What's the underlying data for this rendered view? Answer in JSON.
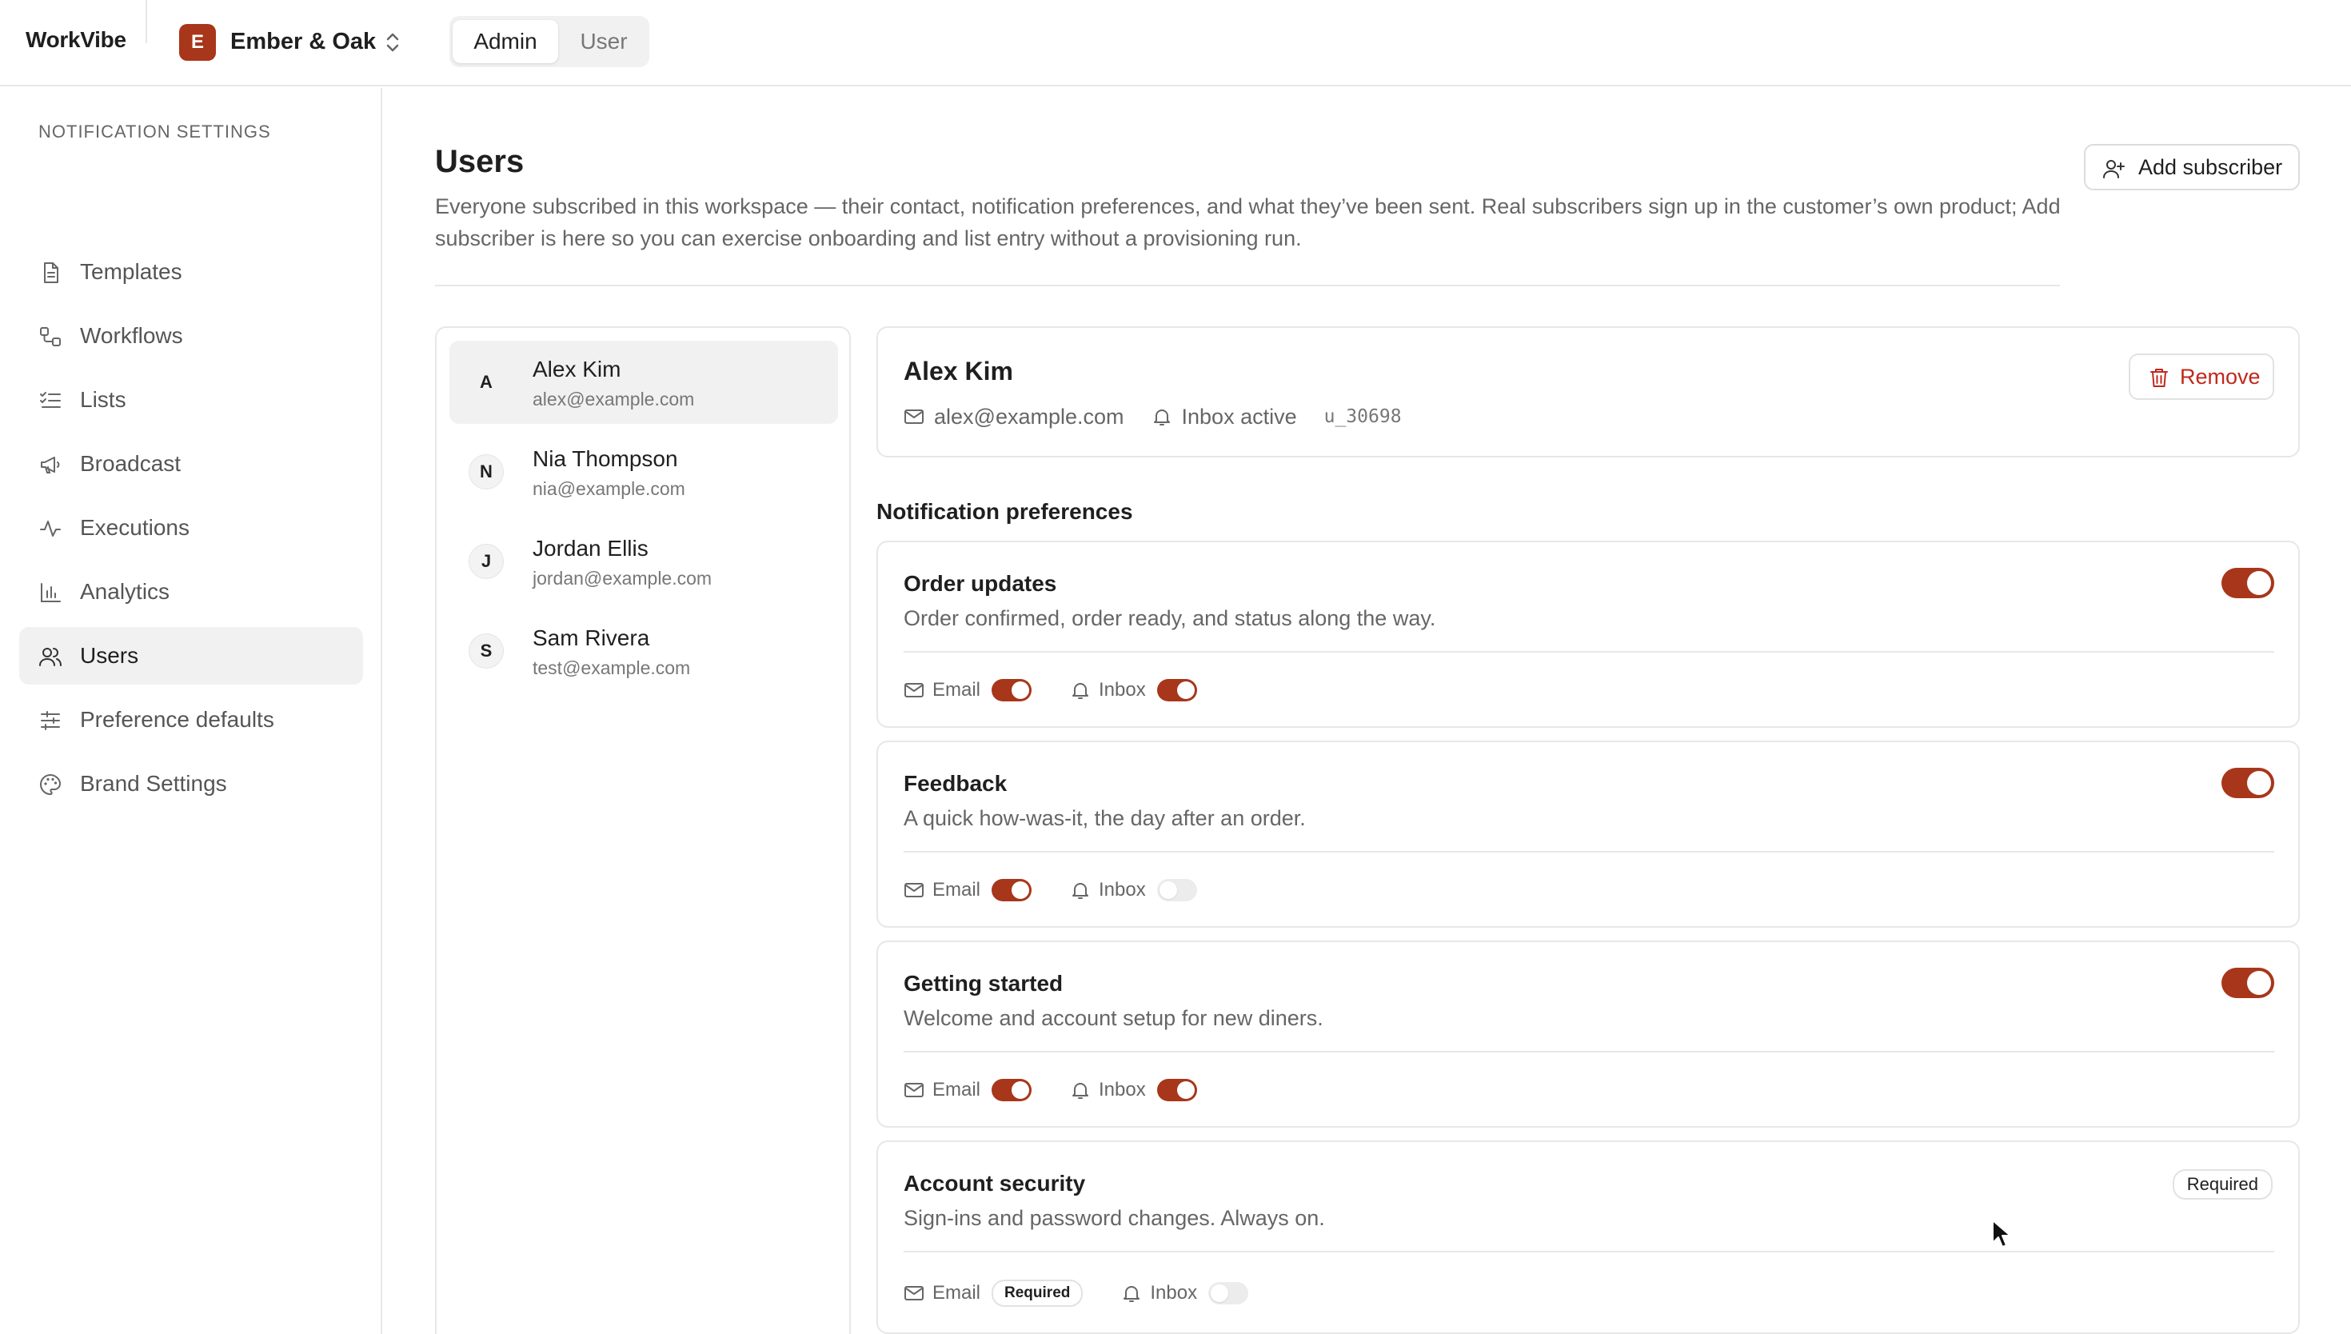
{
  "app": {
    "brand": "WorkVibe",
    "workspace": {
      "initial": "E",
      "name": "Ember & Oak"
    },
    "mode_tabs": {
      "admin": "Admin",
      "user": "User",
      "selected": "Admin"
    }
  },
  "sidebar": {
    "heading": "NOTIFICATION SETTINGS",
    "items": [
      {
        "label": "Templates",
        "icon": "document-icon"
      },
      {
        "label": "Workflows",
        "icon": "workflow-icon"
      },
      {
        "label": "Lists",
        "icon": "checklist-icon"
      },
      {
        "label": "Broadcast",
        "icon": "megaphone-icon"
      },
      {
        "label": "Executions",
        "icon": "activity-icon"
      },
      {
        "label": "Analytics",
        "icon": "bar-chart-icon"
      },
      {
        "label": "Users",
        "icon": "users-icon",
        "active": true
      },
      {
        "label": "Preference defaults",
        "icon": "sliders-icon"
      },
      {
        "label": "Brand Settings",
        "icon": "palette-icon"
      }
    ]
  },
  "page": {
    "title": "Users",
    "description": "Everyone subscribed in this workspace — their contact, notification preferences, and what they’ve been sent. Real subscribers sign up in the customer’s own product; Add subscriber is here so you can exercise onboarding and list entry without a provisioning run.",
    "add_button": "Add subscriber"
  },
  "users": [
    {
      "initial": "A",
      "name": "Alex Kim",
      "email": "alex@example.com",
      "selected": true
    },
    {
      "initial": "N",
      "name": "Nia Thompson",
      "email": "nia@example.com"
    },
    {
      "initial": "J",
      "name": "Jordan Ellis",
      "email": "jordan@example.com"
    },
    {
      "initial": "S",
      "name": "Sam Rivera",
      "email": "test@example.com"
    }
  ],
  "detail": {
    "name": "Alex Kim",
    "email": "alex@example.com",
    "inbox_status": "Inbox active",
    "user_id": "u_30698",
    "remove_button": "Remove"
  },
  "preferences": {
    "heading": "Notification preferences",
    "email_label": "Email",
    "inbox_label": "Inbox",
    "required_label": "Required",
    "items": [
      {
        "title": "Order updates",
        "description": "Order confirmed, order ready, and status along the way.",
        "enabled": true,
        "email": true,
        "inbox": true
      },
      {
        "title": "Feedback",
        "description": "A quick how-was-it, the day after an order.",
        "enabled": true,
        "email": true,
        "inbox": false
      },
      {
        "title": "Getting started",
        "description": "Welcome and account setup for new diners.",
        "enabled": true,
        "email": true,
        "inbox": true
      },
      {
        "title": "Account security",
        "description": "Sign-ins and password changes. Always on.",
        "required": true,
        "email_required": true,
        "inbox": false
      }
    ]
  },
  "colors": {
    "accent": "#a8361a",
    "danger": "#c0281c",
    "border": "#e7e7e7",
    "muted_text": "#666666"
  }
}
